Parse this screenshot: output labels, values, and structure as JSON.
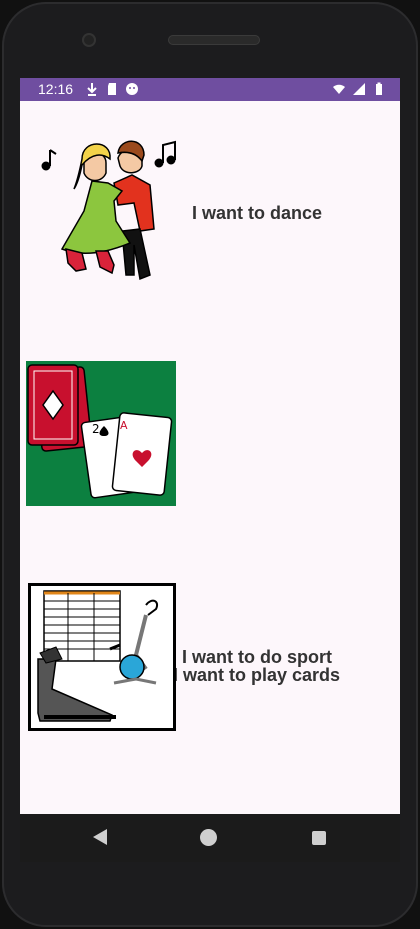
{
  "status_bar": {
    "time": "12:16",
    "left_icons": [
      "download-icon",
      "sd-card-icon",
      "face-icon"
    ],
    "right_icons": [
      "wifi-icon",
      "signal-icon",
      "battery-icon"
    ],
    "color": "#6f4ea0"
  },
  "items": [
    {
      "label": "I want to dance",
      "icon": "dancing-couple-icon"
    },
    {
      "label": "I want to play cards",
      "icon": "playing-cards-icon"
    },
    {
      "label": "I want to do sport",
      "icon": "gym-equipment-icon"
    }
  ],
  "nav_bar": {
    "back": "back-icon",
    "home": "home-icon",
    "recent": "recent-apps-icon"
  }
}
